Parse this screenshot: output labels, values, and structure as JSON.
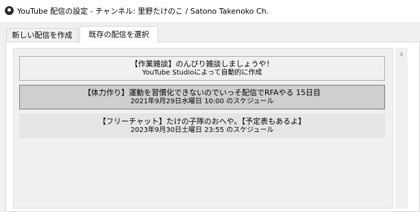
{
  "window": {
    "title": "YouTube 配信の設定 - チャンネル: 里野たけのこ / Satono Takenoko Ch.",
    "app_icon": "obs-icon"
  },
  "tabs": [
    {
      "label": "新しい配信を作成",
      "selected": false
    },
    {
      "label": "既存の配信を選択",
      "selected": true
    }
  ],
  "broadcasts": [
    {
      "title": "【作業雑談】のんびり雑談しましょうや！",
      "subtitle": "YouTube Studioによって自動的に作成",
      "selected": false
    },
    {
      "title": "【体力作り】運動を習慣化できないのでいっそ配信でRFAやる 15日目",
      "subtitle": "2021年9月29日水曜日 10:00 のスケジュール",
      "selected": true
    },
    {
      "title": "【フリーチャット】たけの子隊のおへや。【予定表もあるよ】",
      "subtitle": "2023年9月30日土曜日 23:55 のスケジュール",
      "selected": false
    }
  ],
  "scrollbar": {
    "up_icon": "chevron-up-icon",
    "glyph": "∧"
  }
}
